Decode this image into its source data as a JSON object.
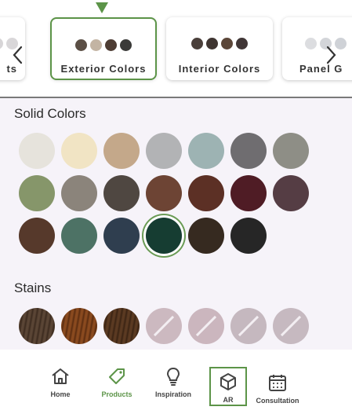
{
  "carousel": {
    "cards": [
      {
        "label": "ts",
        "swatches": [
          "#d7d5d7",
          "#d9d7d9"
        ]
      },
      {
        "label": "Exterior Colors",
        "swatches": [
          "#5b4f45",
          "#c3b4a3",
          "#4d3c33",
          "#3a3a38"
        ],
        "active": true
      },
      {
        "label": "Interior Colors",
        "swatches": [
          "#4a3f3a",
          "#3f3531",
          "#5b4638",
          "#403636"
        ]
      },
      {
        "label": "Panel G",
        "swatches": [
          "#dcdde0",
          "#d3d5d9",
          "#cfd2d7"
        ]
      }
    ],
    "prev_icon": "chevron-left-icon",
    "next_icon": "chevron-right-icon",
    "accent": "#5c9448"
  },
  "sections": {
    "solid_title": "Solid Colors",
    "stains_title": "Stains"
  },
  "solid_colors": [
    "#e6e3dc",
    "#f1e4c4",
    "#c4a88a",
    "#b2b3b5",
    "#9db3b3",
    "#6f6d70",
    "#8e8e86",
    "#86966a",
    "#8b847b",
    "#4f4741",
    "#6d4434",
    "#5c3025",
    "#4f1c25",
    "#553d44",
    "#56392b",
    "#4d7265",
    "#2f3e4f",
    "#163d32",
    "#362a20",
    "#262626"
  ],
  "selected_solid_index": 17,
  "stains": [
    {
      "kind": "wood",
      "base": "#5a4535",
      "grain": "#3b2a1e"
    },
    {
      "kind": "wood",
      "base": "#8a4a1f",
      "grain": "#5a2c10"
    },
    {
      "kind": "wood",
      "base": "#5b3a22",
      "grain": "#3a2313"
    },
    {
      "kind": "unavailable",
      "color": "#ccb9c0"
    },
    {
      "kind": "unavailable",
      "color": "#cbb6be"
    },
    {
      "kind": "unavailable",
      "color": "#c5b8bf"
    },
    {
      "kind": "unavailable",
      "color": "#c6b9c0"
    }
  ],
  "nav": {
    "home": "Home",
    "products": "Products",
    "inspiration": "Inspiration",
    "ar": "AR",
    "consultation": "Consultation"
  }
}
